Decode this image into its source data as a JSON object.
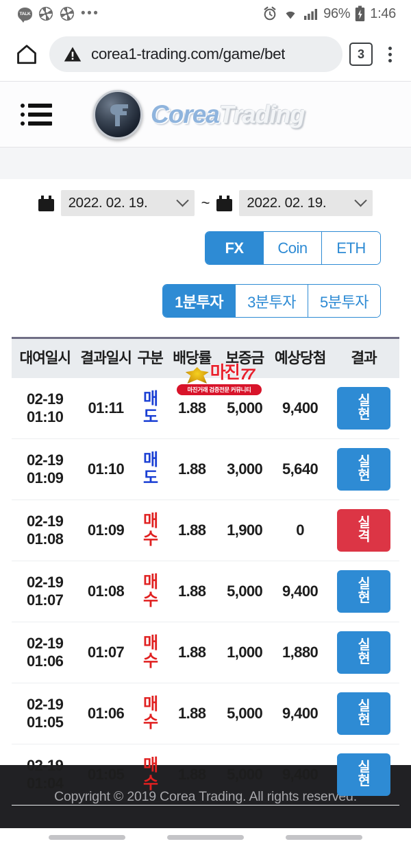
{
  "status_bar": {
    "app_icons": [
      "kakaotalk-icon",
      "aperture-icon",
      "aperture-icon",
      "overflow-dots"
    ],
    "kakao_label": "TALK",
    "alarm_icon": "alarm-icon",
    "wifi_icon": "wifi-icon",
    "signal_icon": "cellular-signal-icon",
    "battery_percent": "96%",
    "battery_icon": "battery-charging-icon",
    "time": "1:46"
  },
  "browser": {
    "home_icon": "home-icon",
    "security_icon": "not-secure-warning-icon",
    "url": "corea1-trading.com/game/bet",
    "tab_count": "3",
    "menu_icon": "kebab-menu-icon"
  },
  "site_header": {
    "menu_icon": "hamburger-menu-icon",
    "logo_mark": "ct-coin-logo",
    "brand_primary": "Corea",
    "brand_secondary": "Trading"
  },
  "filters": {
    "calendar_icon": "calendar-icon",
    "date_from": "2022. 02. 19.",
    "date_to": "2022. 02. 19.",
    "separator": "~",
    "chevron_icon": "chevron-down-icon",
    "market_tabs": [
      {
        "label": "FX",
        "active": true
      },
      {
        "label": "Coin",
        "active": false
      },
      {
        "label": "ETH",
        "active": false
      }
    ],
    "interval_tabs": [
      {
        "label": "1분투자",
        "active": true
      },
      {
        "label": "3분투자",
        "active": false
      },
      {
        "label": "5분투자",
        "active": false
      }
    ]
  },
  "table": {
    "headers": [
      "대여일시",
      "결과일시",
      "구분",
      "배당률",
      "보증금",
      "예상당첨",
      "결과"
    ],
    "rows": [
      {
        "lend_date": "02-19",
        "lend_time": "01:10",
        "result_time": "01:11",
        "side": "매도",
        "side_type": "sell",
        "rate": "1.88",
        "deposit": "5,000",
        "expected": "9,400",
        "result": "실현",
        "result_type": "win"
      },
      {
        "lend_date": "02-19",
        "lend_time": "01:09",
        "result_time": "01:10",
        "side": "매도",
        "side_type": "sell",
        "rate": "1.88",
        "deposit": "3,000",
        "expected": "5,640",
        "result": "실현",
        "result_type": "win"
      },
      {
        "lend_date": "02-19",
        "lend_time": "01:08",
        "result_time": "01:09",
        "side": "매수",
        "side_type": "buy",
        "rate": "1.88",
        "deposit": "1,900",
        "expected": "0",
        "result": "실격",
        "result_type": "lose"
      },
      {
        "lend_date": "02-19",
        "lend_time": "01:07",
        "result_time": "01:08",
        "side": "매수",
        "side_type": "buy",
        "rate": "1.88",
        "deposit": "5,000",
        "expected": "9,400",
        "result": "실현",
        "result_type": "win"
      },
      {
        "lend_date": "02-19",
        "lend_time": "01:06",
        "result_time": "01:07",
        "side": "매수",
        "side_type": "buy",
        "rate": "1.88",
        "deposit": "1,000",
        "expected": "1,880",
        "result": "실현",
        "result_type": "win"
      },
      {
        "lend_date": "02-19",
        "lend_time": "01:05",
        "result_time": "01:06",
        "side": "매수",
        "side_type": "buy",
        "rate": "1.88",
        "deposit": "5,000",
        "expected": "9,400",
        "result": "실현",
        "result_type": "win"
      },
      {
        "lend_date": "02-19",
        "lend_time": "01:04",
        "result_time": "01:05",
        "side": "매수",
        "side_type": "buy",
        "rate": "1.88",
        "deposit": "5,000",
        "expected": "9,400",
        "result": "실현",
        "result_type": "win"
      }
    ]
  },
  "watermark": {
    "emblem_icon": "eagle-emblem-icon",
    "word": "마진",
    "tail": "77",
    "banner": "마진거래 검증전문 커뮤니티"
  },
  "footer": {
    "copyright": "Copyright © 2019 Corea Trading. All rights reserved."
  },
  "colors": {
    "accent_blue": "#2e8bd4",
    "danger_red": "#dc3545",
    "buy_red": "#e02020",
    "sell_blue": "#1a3fd4",
    "header_grey": "#e9ecef",
    "footer_dark": "#212124"
  }
}
